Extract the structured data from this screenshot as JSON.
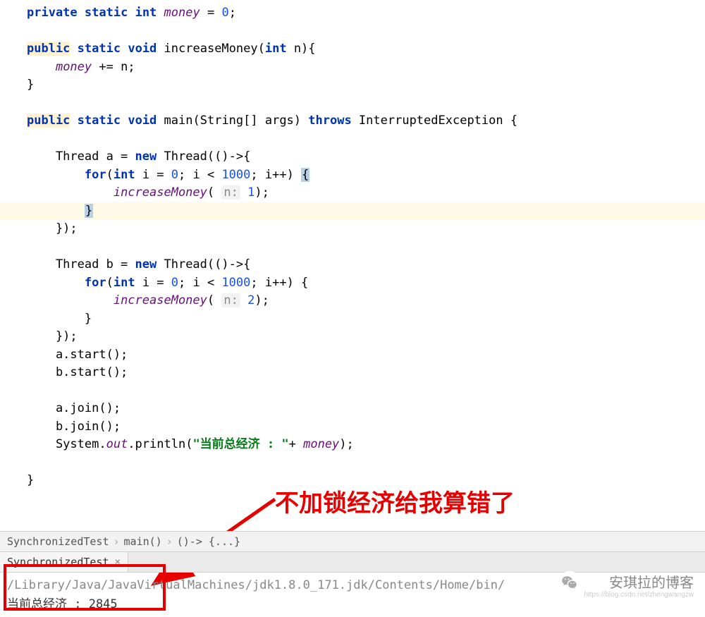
{
  "code": {
    "line1": {
      "private": "private",
      "static": "static",
      "int": "int",
      "money": "money",
      "eq": " = ",
      "zero": "0",
      "semi": ";"
    },
    "line3": {
      "public": "public",
      "static": "static",
      "void": "void",
      "method": "increaseMoney",
      "sig": "(",
      "int": "int",
      "param": " n){"
    },
    "line4": {
      "indent": "    ",
      "money": "money",
      "rest": " += n;"
    },
    "line5": {
      "brace": "}"
    },
    "line7": {
      "public": "public",
      "static": "static",
      "void": "void",
      "main": "main",
      "sig1": "(String[] args) ",
      "throws": "throws",
      "exc": " InterruptedException {"
    },
    "line9": {
      "pre": "    Thread a = ",
      "new": "new",
      "post": " Thread(()->{"
    },
    "line10": {
      "pre": "        ",
      "for": "for",
      "open": "(",
      "int": "int",
      "i_eq": " i = ",
      "zero": "0",
      "cond": "; i < ",
      "thousand": "1000",
      "inc": "; i++) ",
      "brace": "{"
    },
    "line11": {
      "pre": "            ",
      "method": "increaseMoney",
      "open": "( ",
      "pname": "n:",
      "space": " ",
      "val": "1",
      "close": ");"
    },
    "line12": {
      "pre": "        ",
      "brace": "}"
    },
    "line13": {
      "text": "    });"
    },
    "line15": {
      "pre": "    Thread b = ",
      "new": "new",
      "post": " Thread(()->{"
    },
    "line16": {
      "pre": "        ",
      "for": "for",
      "open": "(",
      "int": "int",
      "i_eq": " i = ",
      "zero": "0",
      "cond": "; i < ",
      "thousand": "1000",
      "inc": "; i++) {"
    },
    "line17": {
      "pre": "            ",
      "method": "increaseMoney",
      "open": "( ",
      "pname": "n:",
      "space": " ",
      "val": "2",
      "close": ");"
    },
    "line18": {
      "text": "        }"
    },
    "line19": {
      "text": "    });"
    },
    "line20": {
      "text": "    a.start();"
    },
    "line21": {
      "text": "    b.start();"
    },
    "line23": {
      "text": "    a.join();"
    },
    "line24": {
      "text": "    b.join();"
    },
    "line25": {
      "pre": "    System.",
      "out": "out",
      "print": ".println(",
      "str": "\"当前总经济 : \"",
      "plus": "+ ",
      "money": "money",
      "close": ");"
    },
    "line27": {
      "brace": "}"
    }
  },
  "breadcrumb": {
    "item1": "SynchronizedTest",
    "item2": "main()",
    "item3": "()-> {...}"
  },
  "tab": {
    "name": "SynchronizedTest"
  },
  "console": {
    "path": "/Library/Java/JavaVirtualMachines/jdk1.8.0_171.jdk/Contents/Home/bin/",
    "output": "当前总经济 : 2845"
  },
  "annotation": "不加锁经济给我算错了",
  "watermark": {
    "name": "安琪拉的博客",
    "url": "https://blog.csdn.net/zhengwangzw"
  }
}
